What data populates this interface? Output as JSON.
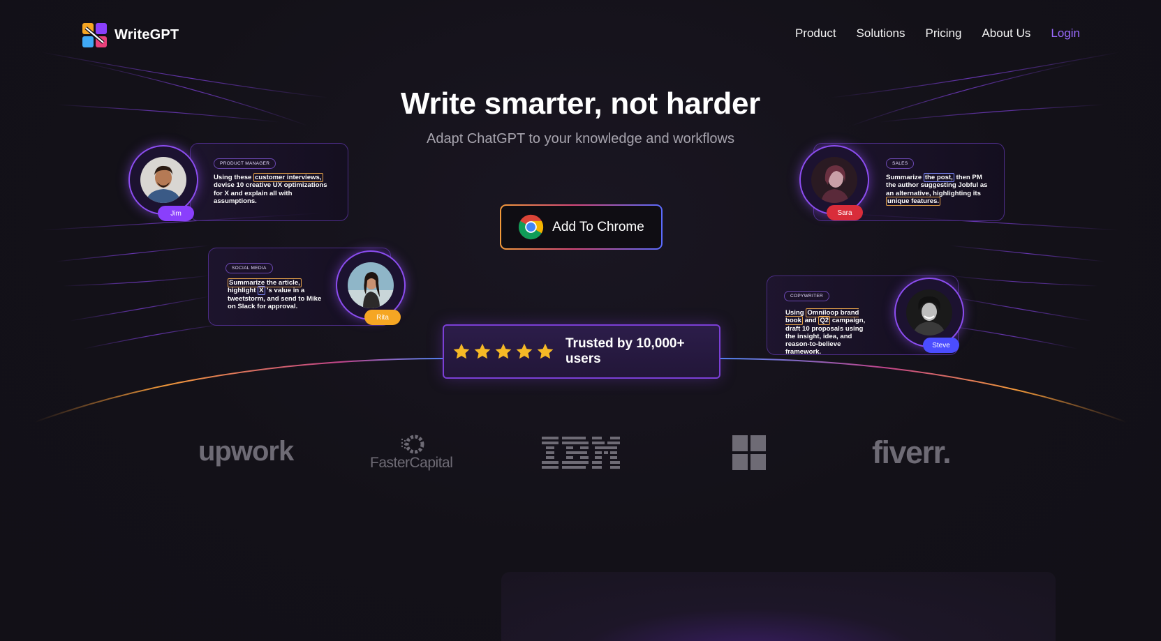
{
  "brand": {
    "name": "WriteGPT"
  },
  "nav": {
    "items": [
      "Product",
      "Solutions",
      "Pricing",
      "About Us"
    ],
    "login": "Login"
  },
  "hero": {
    "title": "Write smarter, not harder",
    "subtitle": "Adapt ChatGPT to your knowledge and workflows",
    "cta": "Add To Chrome",
    "trusted": "Trusted by 10,000+ users",
    "rating_stars": 5
  },
  "cards": {
    "jim": {
      "name": "Jim",
      "tag": "PRODUCT MANAGER",
      "t1": "Using these",
      "h1": "customer interviews,",
      "t2": "devise 10 creative UX optimizations for X and explain all with assumptions."
    },
    "rita": {
      "name": "Rita",
      "tag": "SOCIAL MEDIA",
      "h1": "Summarize the article,",
      "t1": "highlight",
      "h2": "X",
      "t2": "'s value in a tweetstorm, and send to Mike on Slack for approval."
    },
    "sara": {
      "name": "Sara",
      "tag": "SALES",
      "t1": "Summarize",
      "h1": "the post,",
      "t2": "then PM the author suggesting Jobful as an alternative, highlighting its",
      "h2": "unique features."
    },
    "steve": {
      "name": "Steve",
      "tag": "COPYWRITER",
      "t1": "Using",
      "h1": "Omniloop brand book",
      "t2": "and",
      "h2": "Q2",
      "t3": "campaign, draft 10 proposals using the insight, idea, and reason-to-believe framework."
    }
  },
  "logos": {
    "upwork": "upwork",
    "faster": "FasterCapital",
    "fiverr": "fiverr."
  },
  "colors": {
    "accent": "#9b6bff",
    "jim_pill": "#8a3ffc",
    "rita_pill": "#f5a623",
    "sara_pill": "#d92d3a",
    "steve_pill": "#4b4dff",
    "star": "#f6b926"
  },
  "icons": [
    "writegpt-logo-icon",
    "chrome-icon",
    "star-icon",
    "ibm-logo-icon",
    "windows-logo-icon",
    "faster-capital-gear-icon"
  ]
}
